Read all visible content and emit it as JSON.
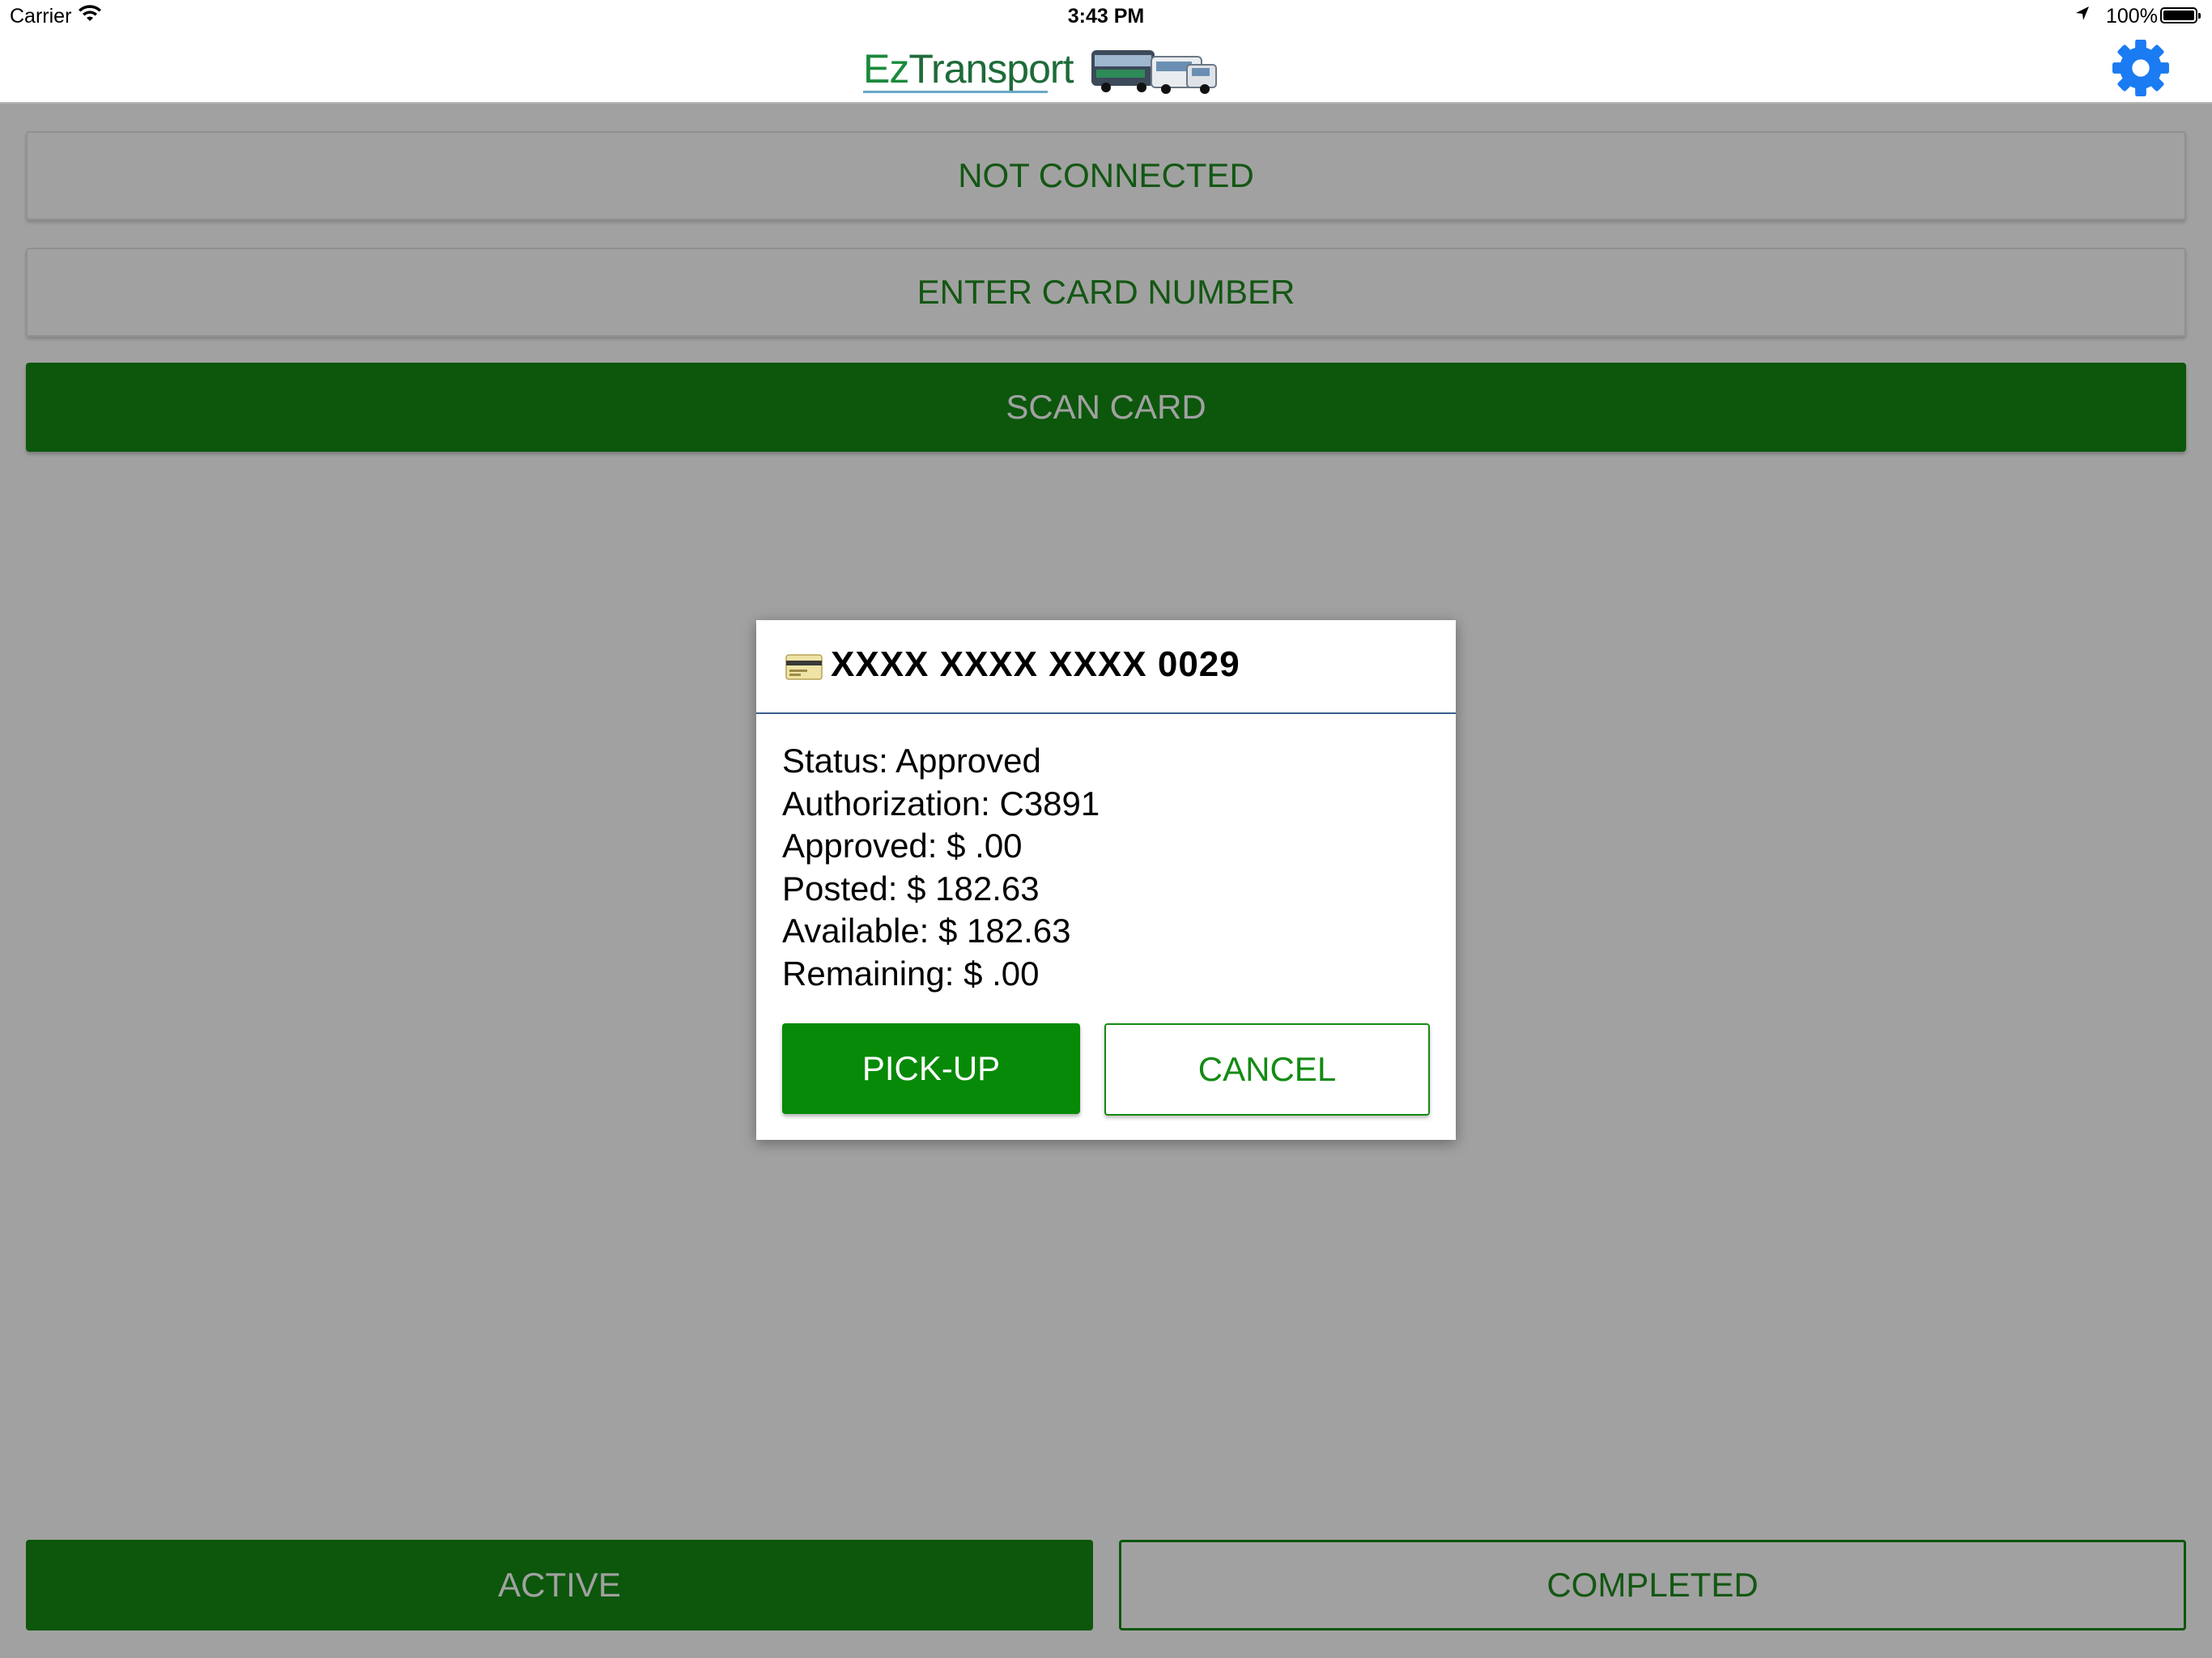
{
  "status_bar": {
    "carrier": "Carrier",
    "time": "3:43 PM",
    "battery": "100%",
    "battery_level": 1.0,
    "icons": [
      "wifi-icon",
      "location-arrow-icon",
      "battery-icon"
    ]
  },
  "nav": {
    "logo_prefix": "Ez",
    "logo_suffix": "Transport",
    "settings_icon": "gear-icon",
    "accent_color": "#1a7bf2"
  },
  "main": {
    "connection_status": "NOT CONNECTED",
    "enter_card_label": "ENTER CARD NUMBER",
    "scan_card_label": "SCAN CARD"
  },
  "tabs": {
    "active_label": "ACTIVE",
    "completed_label": "COMPLETED"
  },
  "dialog": {
    "card_icon": "credit-card-icon",
    "card_number": "XXXX XXXX XXXX 0029",
    "lines": {
      "status": "Status: Approved",
      "authorization": "Authorization: C3891",
      "approved": "Approved: $ .00",
      "posted": "Posted: $ 182.63",
      "available": "Available: $ 182.63",
      "remaining": "Remaining: $ .00"
    },
    "pickup_label": "PICK-UP",
    "cancel_label": "CANCEL"
  },
  "colors": {
    "primary_green": "#138b13",
    "overlay": "rgba(0,0,0,0.37)",
    "header_divider": "#3b5f8f"
  }
}
